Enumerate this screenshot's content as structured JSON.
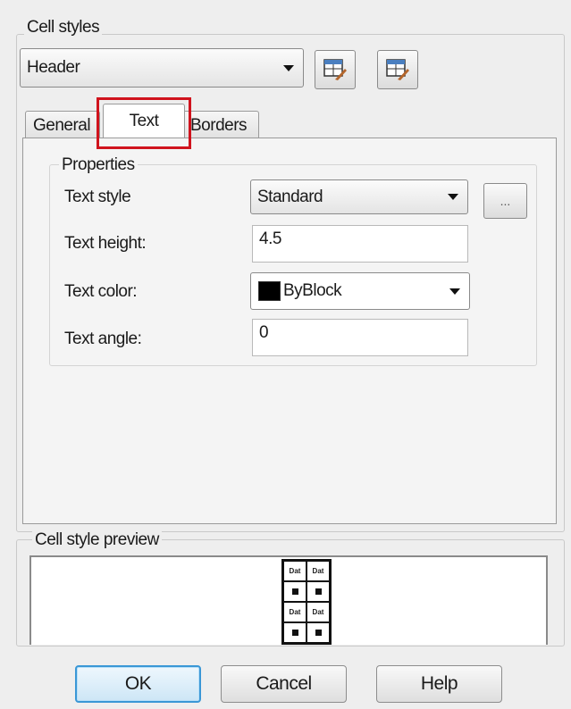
{
  "cell_styles": {
    "group_label": "Cell styles",
    "selected": "Header",
    "buttons": [
      {
        "icon": "launch-table-style-dialog-icon"
      },
      {
        "icon": "create-new-cell-style-icon"
      }
    ]
  },
  "tabs": [
    {
      "label": "General",
      "active": false
    },
    {
      "label": "Text",
      "active": true
    },
    {
      "label": "Borders",
      "active": false
    }
  ],
  "properties": {
    "group_label": "Properties",
    "text_style": {
      "label": "Text style",
      "value": "Standard",
      "browse": "..."
    },
    "text_height": {
      "label": "Text height:",
      "value": "4.5"
    },
    "text_color": {
      "label": "Text color:",
      "value": "ByBlock",
      "swatch": "#000000"
    },
    "text_angle": {
      "label": "Text angle:",
      "value": "0"
    }
  },
  "preview": {
    "group_label": "Cell style preview",
    "cells": [
      "Dat",
      "Dat",
      "",
      "",
      "Dat",
      "Dat",
      "",
      ""
    ]
  },
  "footer": {
    "ok": "OK",
    "cancel": "Cancel",
    "help": "Help"
  },
  "colors": {
    "highlight": "#d0131d",
    "default_button_border": "#3a97d6"
  }
}
